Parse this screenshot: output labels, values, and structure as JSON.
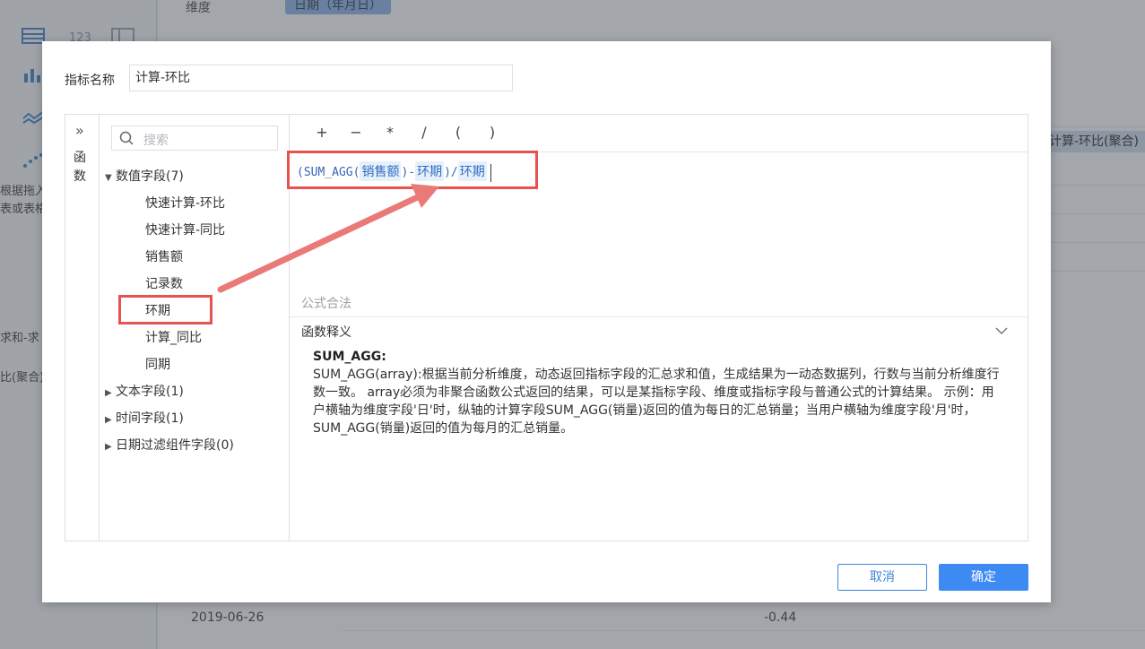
{
  "background": {
    "dimension_label": "维度",
    "date_chip": "日期（年月日）",
    "right_chip": "计算-环比(聚合)",
    "left_hint_1": "根据拖入",
    "left_hint_2": "表或表格",
    "left_text_1": "求和-求",
    "left_text_2": "比(聚合)",
    "table_last_date": "2019-06-26",
    "table_last_value": "-0.44"
  },
  "dialog": {
    "name_label": "指标名称",
    "name_value": "计算-环比",
    "function_tab": "函数",
    "search_placeholder": "搜索",
    "field_groups": [
      {
        "label": "数值字段(7)",
        "expanded": true,
        "items": [
          "快速计算-环比",
          "快速计算-同比",
          "销售额",
          "记录数",
          "环期",
          "计算_同比",
          "同期"
        ]
      },
      {
        "label": "文本字段(1)",
        "expanded": false
      },
      {
        "label": "时间字段(1)",
        "expanded": false
      },
      {
        "label": "日期过滤组件字段(0)",
        "expanded": false
      }
    ],
    "operators": [
      "+",
      "−",
      "*",
      "/",
      "(",
      ")"
    ],
    "formula": {
      "part1": "(SUM_AGG(",
      "field1": "销售额",
      "part2": ")-",
      "field2": "环期",
      "part3": ")/",
      "field3": "环期"
    },
    "formula_status": "公式合法",
    "explain_title": "函数释义",
    "function_name": "SUM_AGG:",
    "function_desc": "SUM_AGG(array):根据当前分析维度，动态返回指标字段的汇总求和值，生成结果为一动态数据列，行数与当前分析维度行数一致。 array必须为非聚合函数公式返回的结果，可以是某指标字段、维度或指标字段与普通公式的计算结果。 示例：用户横轴为维度字段'日'时，纵轴的计算字段SUM_AGG(销量)返回的值为每日的汇总销量；当用户横轴为维度字段'月'时，SUM_AGG(销量)返回的值为每月的汇总销量。",
    "cancel_label": "取消",
    "ok_label": "确定"
  },
  "colors": {
    "accent": "#3e8af3",
    "annotation_red": "#e8524f"
  }
}
